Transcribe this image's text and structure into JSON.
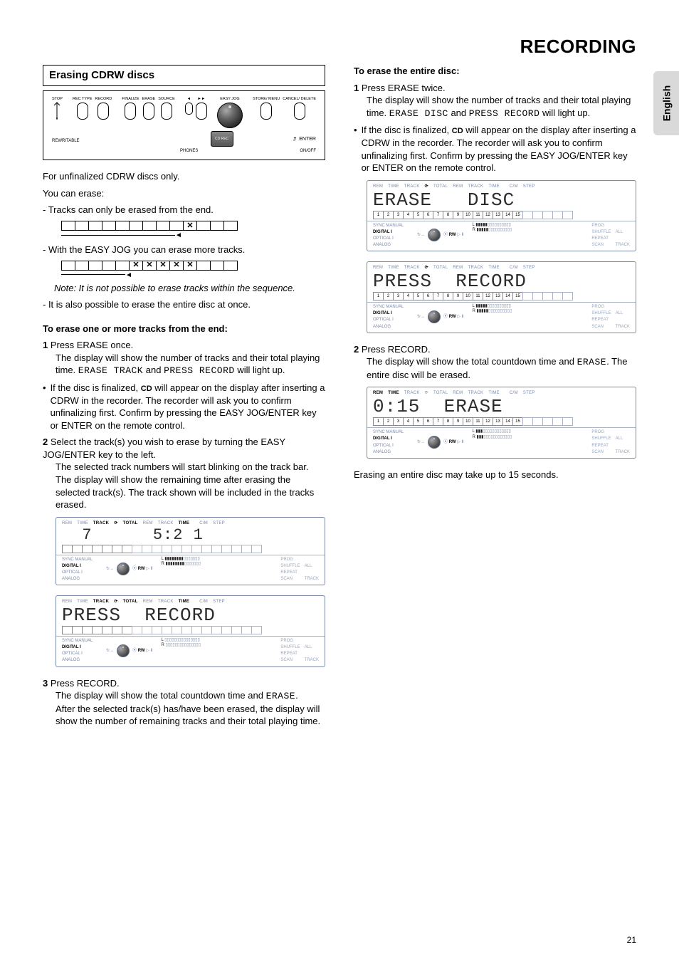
{
  "meta": {
    "domain": "Document"
  },
  "header": {
    "title": "RECORDING"
  },
  "side_tab": {
    "label": "English"
  },
  "left": {
    "box_heading": "Erasing CDRW discs",
    "controls": {
      "top": [
        {
          "label": "STOP",
          "sub": ""
        },
        {
          "label": "REC TYPE",
          "sub": ""
        },
        {
          "label": "RECORD",
          "sub": ""
        },
        {
          "label": "FINALIZE",
          "sub": ""
        },
        {
          "label": "ERASE",
          "sub": ""
        },
        {
          "label": "SOURCE",
          "sub": ""
        },
        {
          "label": "◄",
          "sub": ""
        },
        {
          "label": "►►",
          "sub": ""
        },
        {
          "label": "EASY JOG",
          "sub": ""
        },
        {
          "label": "STORE/ MENU",
          "sub": ""
        },
        {
          "label": "CANCEL/ DELETE",
          "sub": ""
        }
      ],
      "rewritable": "REWRITABLE",
      "rec_badge": "CD REC",
      "enter": "ENTER",
      "bottom_left": "PHONES",
      "bottom_right": "ON/OFF"
    },
    "intro1": "For unfinalized CDRW discs only.",
    "intro2": "You can erase:",
    "bullet1": "- Tracks can only be erased from the end.",
    "bullet2": "- With the EASY JOG you can erase more tracks.",
    "strip1_mark_index": 10,
    "strip2_mark_indices": [
      5,
      6,
      7,
      8,
      9
    ],
    "note": "Note: It is not possible to erase tracks within the sequence.",
    "bullet3": "- It is also possible to erase the entire disc at once.",
    "subhead1": "To erase one or more tracks from the end:",
    "step1_num": "1",
    "step1_text": "Press ERASE once.",
    "step1_body_a": "The display will show the number of tracks and their total playing time.",
    "step1_body_seg1": "ERASE TRACK",
    "step1_body_join": "and",
    "step1_body_seg2": "PRESS RECORD",
    "step1_body_b": "will light up.",
    "dot_note_1a": "If the disc is finalized,",
    "dot_note_1b": "will appear on the display after inserting a CDRW in the recorder. The recorder will ask you to confirm unfinalizing first. Confirm by pressing the EASY JOG/ENTER key or ENTER on the remote control.",
    "dot_note_cd": "CD",
    "step2_num": "2",
    "step2_text": "Select the track(s) you wish to erase by turning the EASY JOG/ENTER key to the left.",
    "step2_body_a": "The selected track numbers will start blinking on the track bar.",
    "step2_body_b": "The display will show the remaining time after erasing the selected track(s). The track shown will be included in the tracks erased.",
    "step3_num": "3",
    "step3_text": "Press RECORD.",
    "step3_body_a": "The display will show the total countdown time and",
    "step3_body_seg": "ERASE",
    "step3_body_b": ".",
    "step3_body_c": "After the selected track(s) has/have been erased, the display will show the number of remaining tracks and their total playing time.",
    "display1": {
      "legend": [
        "REM",
        "TIME",
        "TRACK",
        "⟳",
        "TOTAL",
        "REM",
        "TRACK",
        "TIME",
        "",
        "C/M",
        "STEP"
      ],
      "legend_active": [
        false,
        false,
        true,
        true,
        true,
        false,
        false,
        true,
        false,
        false,
        false
      ],
      "seg_left": "  7",
      "seg_right": "5:2 1",
      "trackbar_count": 20,
      "trackbar_active_to": 7,
      "bot": {
        "sync": "SYNC",
        "manual": "MANUAL",
        "digital": "DIGITAL I",
        "optical": "OPTICAL I",
        "analog": "ANALOG",
        "rw": "RW",
        "lr_l": "L",
        "lr_r": "R",
        "prog": "PROG",
        "shuffle": "SHUFFLE",
        "all": "ALL",
        "repeat": "REPEAT",
        "scan": "SCAN",
        "track": "TRACK"
      }
    },
    "display2": {
      "legend": [
        "REM",
        "TIME",
        "TRACK",
        "⟳",
        "TOTAL",
        "REM",
        "TRACK",
        "TIME",
        "",
        "C/M",
        "STEP"
      ],
      "legend_active": [
        false,
        false,
        true,
        true,
        true,
        false,
        false,
        true,
        false,
        false,
        false
      ],
      "seg_text": "PRESS  RECORD",
      "trackbar_count": 20,
      "trackbar_active_to": 7
    }
  },
  "right": {
    "subhead": "To erase the entire disc:",
    "step1_num": "1",
    "step1_text": "Press ERASE twice.",
    "step1_body_a": "The display will show the number of tracks and their total playing time.",
    "step1_body_seg1": "ERASE DISC",
    "step1_body_join": "and",
    "step1_body_seg2": "PRESS RECORD",
    "step1_body_b": "will light up.",
    "dot_note_1a": "If the disc is finalized,",
    "dot_note_cd": "CD",
    "dot_note_1b": "will appear on the display after inserting a CDRW in the recorder. The recorder will ask you to confirm unfinalizing first. Confirm by pressing the EASY JOG/ENTER key or ENTER on the remote control.",
    "display1": {
      "legend": [
        "REM",
        "TIME",
        "TRACK",
        "⟳",
        "TOTAL",
        "REM",
        "TRACK",
        "TIME",
        "",
        "C/M",
        "STEP"
      ],
      "seg_text": "ERASE   DISC",
      "trackbar_count": 20,
      "trackbar_active_to": 15,
      "trackbar_numbers": true
    },
    "display2": {
      "legend": [
        "REM",
        "TIME",
        "TRACK",
        "⟳",
        "TOTAL",
        "REM",
        "TRACK",
        "TIME",
        "",
        "C/M",
        "STEP"
      ],
      "seg_text": "PRESS  RECORD",
      "trackbar_count": 20,
      "trackbar_active_to": 15,
      "trackbar_numbers": true
    },
    "step2_num": "2",
    "step2_text": "Press RECORD.",
    "step2_body_a": "The display will show the total countdown time and",
    "step2_body_seg": "ERASE",
    "step2_body_b": ". The entire disc will be erased.",
    "display3": {
      "legend": [
        "REM",
        "TIME",
        "TRACK",
        "⟳",
        "TOTAL",
        "REM",
        "TRACK",
        "TIME",
        "",
        "C/M",
        "STEP"
      ],
      "legend_active": [
        true,
        true,
        false,
        false,
        false,
        false,
        false,
        false,
        false,
        false,
        false
      ],
      "seg_left": "0:15",
      "seg_text": "ERASE",
      "trackbar_count": 20,
      "trackbar_active_to": 15,
      "trackbar_numbers": true
    },
    "closing": "Erasing an entire disc may take up to 15 seconds."
  },
  "page_number": "21"
}
